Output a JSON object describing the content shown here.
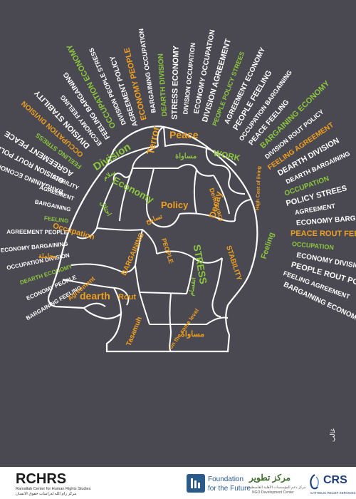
{
  "colors": {
    "background": "#4a4850",
    "white": "#ffffff",
    "orange": "#f0a020",
    "green": "#8cc63f"
  },
  "pieces": [
    {
      "text": "Division",
      "color": "#8cc63f"
    },
    {
      "text": "Terror",
      "color": "#f0a020"
    },
    {
      "text": "Peace",
      "color": "#f0a020"
    },
    {
      "text": "WORK",
      "color": "#8cc63f"
    },
    {
      "text": "Economy",
      "color": "#8cc63f"
    },
    {
      "text": "Policy",
      "color": "#f0a020"
    },
    {
      "text": "Democracy",
      "color": "#f0a020"
    },
    {
      "text": "Decay",
      "color": "#f0a020"
    },
    {
      "text": "High Cost of living",
      "color": "#f0a020"
    },
    {
      "text": "Occupation",
      "color": "#f0a020"
    },
    {
      "text": "BARGAINING",
      "color": "#f0a020"
    },
    {
      "text": "PEOPLE",
      "color": "#f0a020"
    },
    {
      "text": "STRESS",
      "color": "#8cc63f"
    },
    {
      "text": "STABILITY",
      "color": "#f0a020"
    },
    {
      "text": "Feeling",
      "color": "#8cc63f"
    },
    {
      "text": "Agreement",
      "color": "#f0a020"
    },
    {
      "text": "dearth",
      "color": "#f0a020"
    },
    {
      "text": "Rout",
      "color": "#f0a020"
    },
    {
      "text": "Tasamuh",
      "color": "#f0a020"
    },
    {
      "text": "on the same level",
      "color": "#f0a020"
    },
    {
      "text": "مساواة",
      "color": "#f0a020"
    },
    {
      "text": "مساواة",
      "color": "#8cc63f"
    },
    {
      "text": "تسامح",
      "color": "#f0a020"
    },
    {
      "text": "احتلال",
      "color": "#8cc63f"
    },
    {
      "text": "مجاملة",
      "color": "#f0a020"
    },
    {
      "text": "انقسام",
      "color": "#8cc63f"
    },
    {
      "text": "سلام",
      "color": "#8cc63f"
    }
  ],
  "rays": [
    "BARGAINING ECONOMY FEELING",
    "DIVISION ROUT POLICY",
    "AGREEMENT PEACE",
    "FEELING STRESS",
    "OCCUPATION DIVISION",
    "DIVISION STABILITY",
    "ECONOMY FEELING",
    "FEELING BARGAINING",
    "OCCUPATION ECONOMY",
    "DIVISION PEOPLE STRESS",
    "AGREEMENT POLICY",
    "ECONOMY PEOPLE",
    "BARGAINING OCCUPATION",
    "DEARTH DIVISION",
    "STRESS ECONOMY",
    "DIVISION OCCUPATION",
    "ECONOMY OCCUPATION",
    "DIVISION AGREEMENT",
    "PEOPLE POLICY STREES",
    "AGREEMENT ECONOMY",
    "PEOPLE FEELING",
    "OCCUPATION BARGAINING",
    "PEACE FEELING",
    "BARGAINING ECONOMY",
    "DIVISION ROUT POLICY",
    "FEELING AGREEMENT",
    "DEARTH DIVISION",
    "DEARTH BARGAINING",
    "OCCUPATION",
    "POLICY STREES",
    "AGREEMENT",
    "ECONOMY BARGAINING",
    "PEACE ROUT FEELING",
    "OCCUPATION",
    "ECONOMY DIVISION DEARTH",
    "PEOPLE ROUT POLICY STREES",
    "FEELING AGREEMENT",
    "BARGAINING ECONOMY"
  ],
  "left_rays": [
    "BARGAINING FEELING",
    "ECONOMY PEOPLE",
    "DEARTH ECONOMY",
    "OCCUPATION DIVISION",
    "ECONOMY BARGAINING",
    "AGREEMENT PEOPLE",
    "FEELING",
    "BARGAINING",
    "AGREEMENT",
    "STABILITY"
  ],
  "signature": "غالب",
  "footer": {
    "rchrs": {
      "logo": "RCHRS",
      "english": "Ramallah Center for Human Rights Studies",
      "arabic": "مركز رام الله لدراسات حقوق الانسان"
    },
    "fff": {
      "line1": "Foundation",
      "line2": "for the Future"
    },
    "ndc": {
      "arabic": "مركز تطوير",
      "sub": "مركز دعم المؤسسات الأهلية الفلسطينية",
      "english": "NGO Development Center"
    },
    "crs": {
      "logo": "CRS",
      "sub": "CATHOLIC RELIEF SERVICES"
    }
  }
}
